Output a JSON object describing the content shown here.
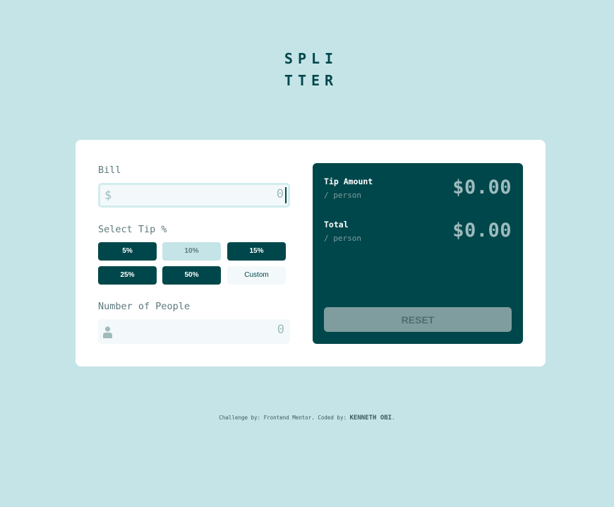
{
  "logo": {
    "line1": "SPLI",
    "line2": "TTER"
  },
  "form": {
    "bill_label": "Bill",
    "bill_prefix": "$",
    "bill_value": "0",
    "tip_label": "Select Tip %",
    "tips": [
      {
        "label": "5%",
        "state": "default"
      },
      {
        "label": "10%",
        "state": "selected"
      },
      {
        "label": "15%",
        "state": "default"
      },
      {
        "label": "25%",
        "state": "default"
      },
      {
        "label": "50%",
        "state": "default"
      },
      {
        "label": "Custom",
        "state": "custom"
      }
    ],
    "people_label": "Number of People",
    "people_icon": "person-icon",
    "people_value": "0"
  },
  "result": {
    "tip_label": "Tip Amount",
    "tip_sub": "/ person",
    "tip_value": "$0.00",
    "total_label": "Total",
    "total_sub": "/ person",
    "total_value": "$0.00",
    "reset_label": "RESET"
  },
  "footer": {
    "prefix": "Challenge by: Frontend Mentor. Coded by: ",
    "author": "KENNETH OBI",
    "suffix": "."
  },
  "colors": {
    "background": "#c5e4e7",
    "primary": "#00474b",
    "card": "#ffffff",
    "muted": "#9ebbbd"
  }
}
